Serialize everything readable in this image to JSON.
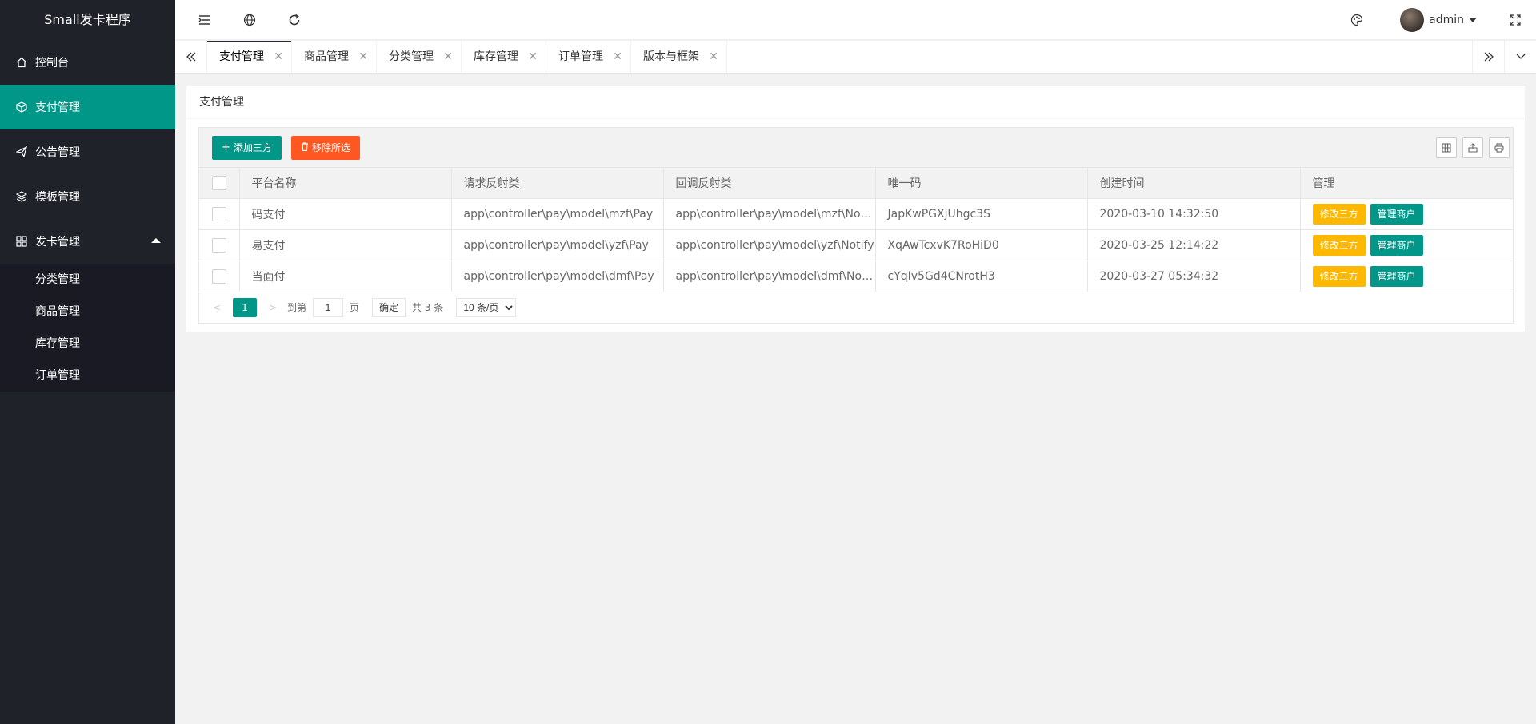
{
  "app": {
    "title": "Small发卡程序"
  },
  "sidebar": {
    "items": [
      {
        "label": "控制台",
        "icon": "home-icon",
        "active": false
      },
      {
        "label": "支付管理",
        "icon": "cube-icon",
        "active": true
      },
      {
        "label": "公告管理",
        "icon": "send-icon",
        "active": false
      },
      {
        "label": "模板管理",
        "icon": "layers-icon",
        "active": false
      },
      {
        "label": "发卡管理",
        "icon": "app-grid-icon",
        "active": false,
        "expanded": true
      }
    ],
    "subitems": [
      "分类管理",
      "商品管理",
      "库存管理",
      "订单管理"
    ]
  },
  "header": {
    "user": "admin"
  },
  "tabs": [
    {
      "label": "支付管理",
      "active": true
    },
    {
      "label": "商品管理",
      "active": false
    },
    {
      "label": "分类管理",
      "active": false
    },
    {
      "label": "库存管理",
      "active": false
    },
    {
      "label": "订单管理",
      "active": false
    },
    {
      "label": "版本与框架",
      "active": false
    }
  ],
  "card": {
    "title": "支付管理"
  },
  "toolbar": {
    "add_label": "添加三方",
    "delete_label": "移除所选"
  },
  "table": {
    "columns": [
      "平台名称",
      "请求反射类",
      "回调反射类",
      "唯一码",
      "创建时间",
      "管理"
    ],
    "rows": [
      {
        "name": "码支付",
        "request": "app\\controller\\pay\\model\\mzf\\Pay",
        "callback": "app\\controller\\pay\\model\\mzf\\Notify",
        "code": "JapKwPGXjUhgc3S",
        "created": "2020-03-10 14:32:50"
      },
      {
        "name": "易支付",
        "request": "app\\controller\\pay\\model\\yzf\\Pay",
        "callback": "app\\controller\\pay\\model\\yzf\\Notify",
        "code": "XqAwTcxvK7RoHiD0",
        "created": "2020-03-25 12:14:22"
      },
      {
        "name": "当面付",
        "request": "app\\controller\\pay\\model\\dmf\\Pay",
        "callback": "app\\controller\\pay\\model\\dmf\\Notify",
        "code": "cYqIv5Gd4CNrotH3",
        "created": "2020-03-27 05:34:32"
      }
    ],
    "actions": {
      "edit": "修改三方",
      "manage": "管理商户"
    }
  },
  "pager": {
    "current": "1",
    "goto_label": "到第",
    "page_input": "1",
    "page_label": "页",
    "confirm": "确定",
    "total": "共 3 条",
    "page_size": "10 条/页"
  },
  "colors": {
    "sidebar": "#20222a",
    "accent": "#009688",
    "danger": "#ff5722",
    "warm": "#ffb800"
  }
}
